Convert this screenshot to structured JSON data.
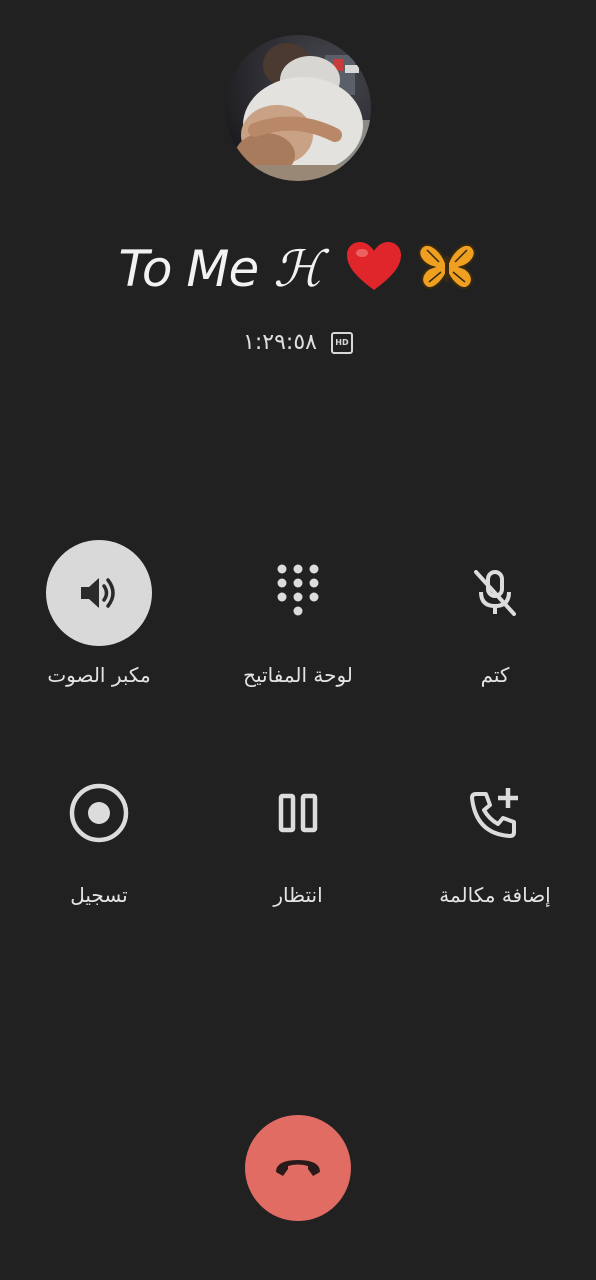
{
  "call": {
    "contact_name_prefix": "To Me ",
    "contact_name_script": "ℋ",
    "contact_name_emoji": "❤️🦋",
    "timer": "١:٢٩:٥٨",
    "hd_badge": "HD"
  },
  "controls": {
    "speaker_label": "مكبر الصوت",
    "keypad_label": "لوحة المفاتيح",
    "mute_label": "كتم",
    "record_label": "تسجيل",
    "hold_label": "انتظار",
    "add_call_label": "إضافة مكالمة"
  },
  "state": {
    "speaker_active": true
  },
  "colors": {
    "background": "#212121",
    "icon": "#dcdcdc",
    "active_button": "#d9d9d9",
    "end_call": "#e06c64",
    "heart": "#e0262b",
    "butterfly": "#f0a020"
  },
  "icons": {
    "speaker": "speaker-icon",
    "keypad": "dialpad-icon",
    "mute": "mic-off-icon",
    "record": "record-icon",
    "hold": "pause-icon",
    "add_call": "add-call-icon",
    "end_call": "hang-up-icon"
  }
}
